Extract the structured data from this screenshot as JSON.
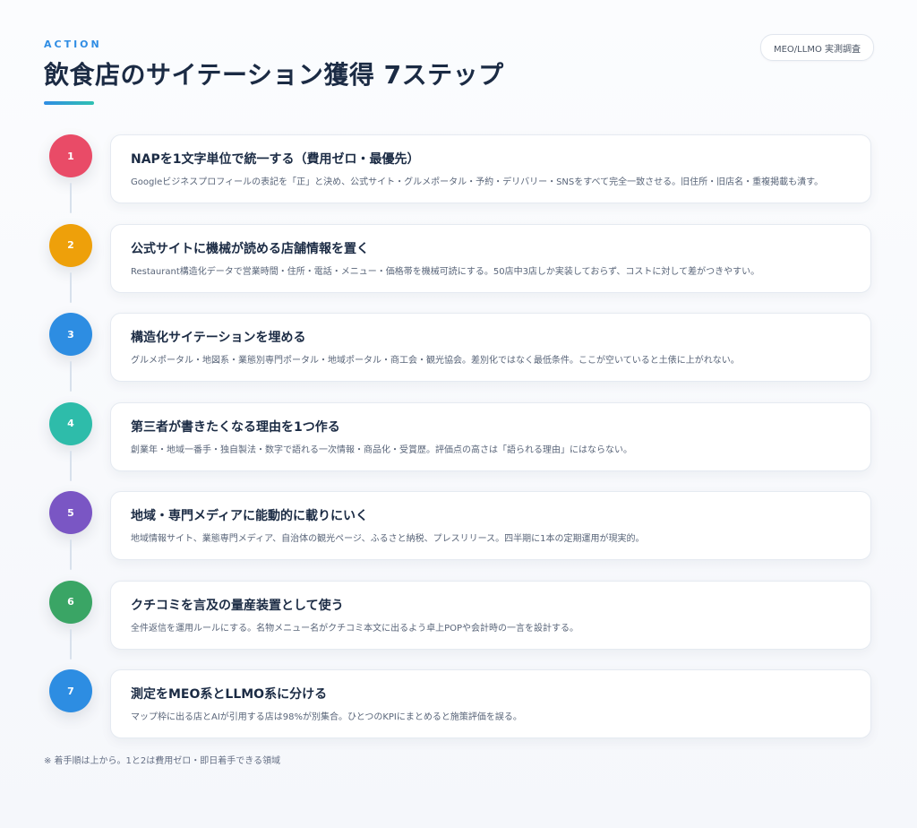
{
  "header": {
    "eyebrow": "ACTION",
    "title": "飲食店のサイテーション獲得 7ステップ",
    "badge": "MEO/LLMO 実測調査"
  },
  "steps": [
    {
      "number": "1",
      "title": "NAPを1文字単位で統一する（費用ゼロ・最優先）",
      "description": "Googleビジネスプロフィールの表記を「正」と決め、公式サイト・グルメポータル・予約・デリバリー・SNSをすべて完全一致させる。旧住所・旧店名・重複掲載も潰す。",
      "color": "#e94b67"
    },
    {
      "number": "2",
      "title": "公式サイトに機械が読める店舗情報を置く",
      "description": "Restaurant構造化データで営業時間・住所・電話・メニュー・価格帯を機械可読にする。50店中3店しか実装しておらず、コストに対して差がつきやすい。",
      "color": "#eea00a"
    },
    {
      "number": "3",
      "title": "構造化サイテーションを埋める",
      "description": "グルメポータル・地図系・業態別専門ポータル・地域ポータル・商工会・観光協会。差別化ではなく最低条件。ここが空いていると土俵に上がれない。",
      "color": "#2d8de2"
    },
    {
      "number": "4",
      "title": "第三者が書きたくなる理由を1つ作る",
      "description": "創業年・地域一番手・独自製法・数字で語れる一次情報・商品化・受賞歴。評価点の高さは「語られる理由」にはならない。",
      "color": "#2ebcaa"
    },
    {
      "number": "5",
      "title": "地域・専門メディアに能動的に載りにいく",
      "description": "地域情報サイト、業態専門メディア、自治体の観光ページ、ふるさと納税、プレスリリース。四半期に1本の定期運用が現実的。",
      "color": "#7a56c4"
    },
    {
      "number": "6",
      "title": "クチコミを言及の量産装置として使う",
      "description": "全件返信を運用ルールにする。名物メニュー名がクチコミ本文に出るよう卓上POPや会計時の一言を設計する。",
      "color": "#3aa565"
    },
    {
      "number": "7",
      "title": "測定をMEO系とLLMO系に分ける",
      "description": "マップ枠に出る店とAIが引用する店は98%が別集合。ひとつのKPIにまとめると施策評価を誤る。",
      "color": "#2d8de2"
    }
  ],
  "footnote": "※ 着手順は上から。1と2は費用ゼロ・即日着手できる領域"
}
